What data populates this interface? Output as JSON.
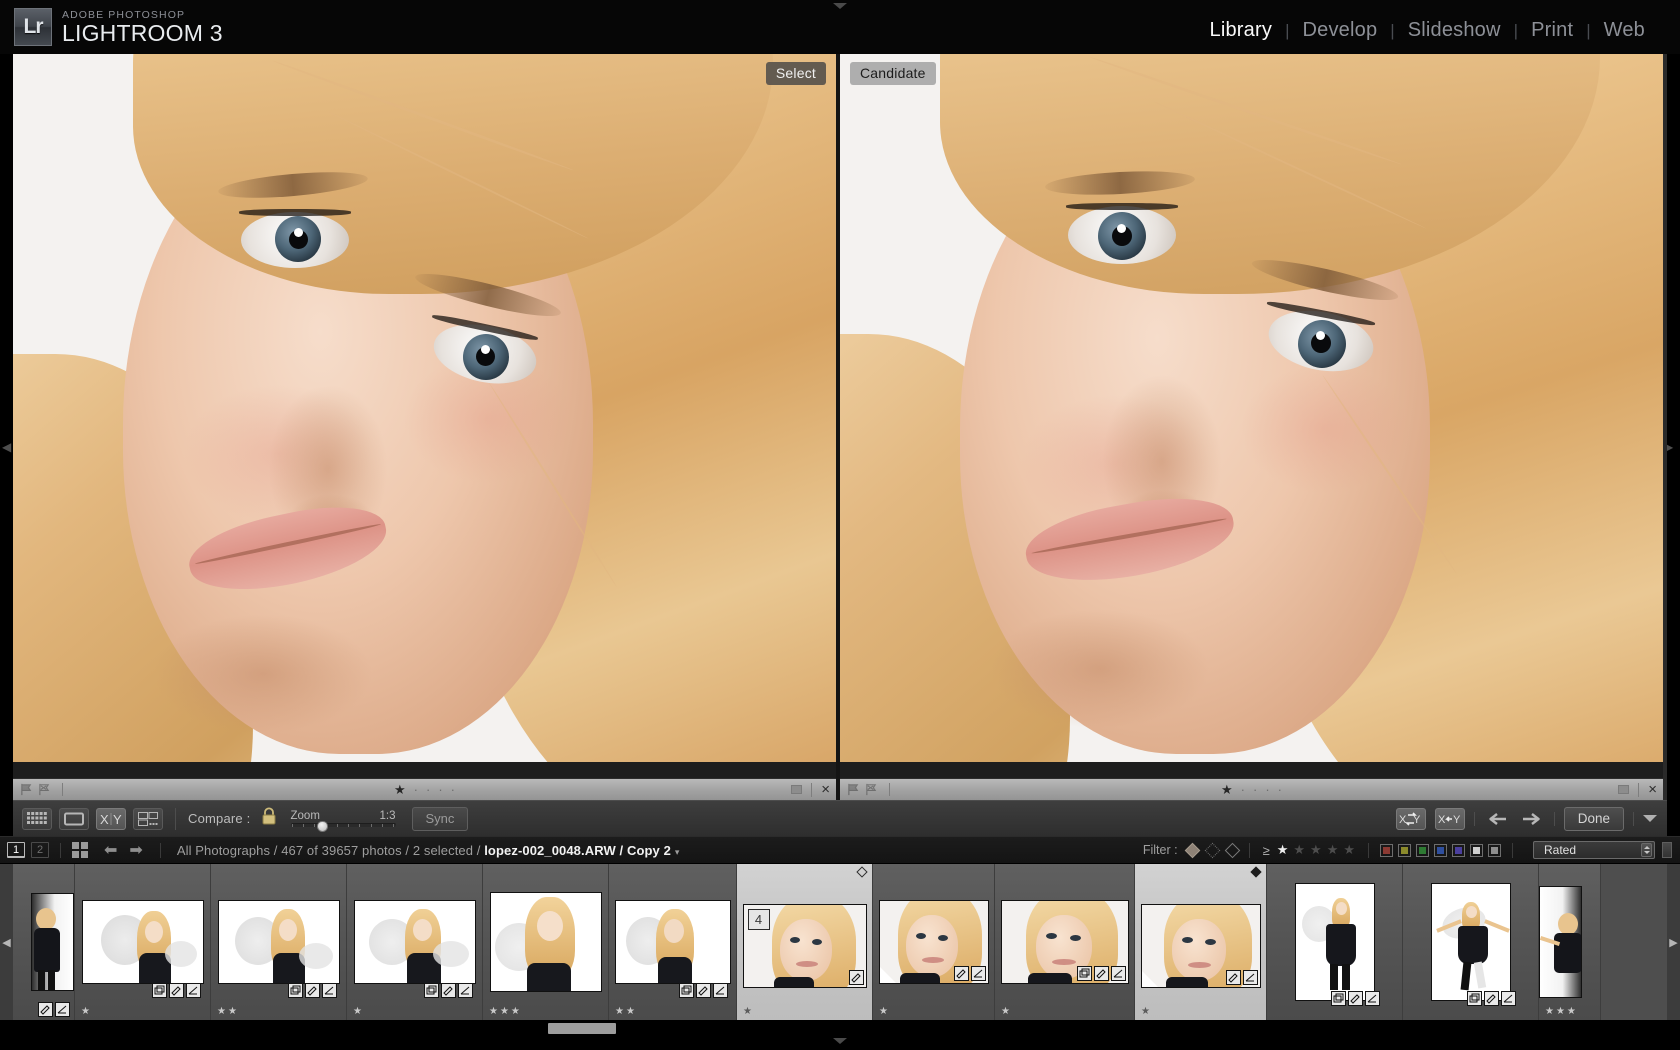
{
  "app": {
    "brand_sub": "ADOBE PHOTOSHOP",
    "brand_main": "LIGHTROOM",
    "brand_version": "3",
    "logo_text": "Lr"
  },
  "modules": [
    {
      "label": "Library",
      "active": true
    },
    {
      "label": "Develop",
      "active": false
    },
    {
      "label": "Slideshow",
      "active": false
    },
    {
      "label": "Print",
      "active": false
    },
    {
      "label": "Web",
      "active": false
    }
  ],
  "module_separator": "|",
  "compare": {
    "left_label": "Select",
    "right_label": "Candidate",
    "left_info": {
      "rating_stars": 1,
      "total_stars": 5,
      "flag_icon": "flag-icon",
      "reject_icon": "reject-flag-icon",
      "close_icon": "×"
    },
    "right_info": {
      "rating_stars": 1,
      "total_stars": 5,
      "flag_icon": "flag-icon",
      "reject_icon": "reject-flag-icon",
      "close_icon": "×"
    }
  },
  "toolbar": {
    "view_buttons": [
      {
        "name": "grid-view",
        "icon": "grid-icon",
        "selected": false
      },
      {
        "name": "loupe-view",
        "icon": "loupe-icon",
        "selected": false
      },
      {
        "name": "compare-view",
        "icon": "compare-xy-icon",
        "selected": true
      },
      {
        "name": "survey-view",
        "icon": "survey-icon",
        "selected": false
      }
    ],
    "compare_label": "Compare :",
    "lock_icon": "lock-icon",
    "zoom_label": "Zoom",
    "zoom_value": "1:3",
    "sync_label": "Sync",
    "swap_icon": "swap-xy-icon",
    "make_select_icon": "make-select-icon",
    "prev_icon": "arrow-left-icon",
    "next_icon": "arrow-right-icon",
    "done_label": "Done",
    "caret_icon": "chevron-down-icon"
  },
  "filmstrip_header": {
    "page_primary": "1",
    "page_secondary": "2",
    "grid_icon": "grid-square-icon",
    "back_icon": "arrow-left-icon",
    "forward_icon": "arrow-right-icon",
    "breadcrumb_prefix": "All Photographs / 467 of 39657 photos / 2 selected / ",
    "breadcrumb_file": "lopez-002_0048.ARW / Copy 2",
    "breadcrumb_caret": "▾",
    "filter_label": "Filter :",
    "filter_flags": [
      "flag-pick-filled",
      "flag-unflagged-dotted",
      "flag-reject-outline"
    ],
    "rating_operator": "≥",
    "rating_stars": 1,
    "rating_total": 5,
    "color_labels": [
      "#8c3a33",
      "#8b8a2b",
      "#2e7a33",
      "#2f4f9e",
      "#4b3f9e",
      "#cfcfcf",
      "#8f8f8f"
    ],
    "preset_value": "Rated"
  },
  "filmstrip": {
    "prev_arrow": "◀",
    "next_arrow": "▶",
    "cells": [
      {
        "id": "c0",
        "kind": "partial-left",
        "orientation": "portrait",
        "stars": 0,
        "selected": false,
        "badges": [
          "crop-icon",
          "adjust-icon"
        ],
        "subject": "full-body"
      },
      {
        "id": "c1",
        "kind": "normal",
        "orientation": "landscape",
        "stars": 1,
        "selected": false,
        "badges": [
          "stack-icon",
          "crop-icon",
          "adjust-icon"
        ],
        "subject": "half-body"
      },
      {
        "id": "c2",
        "kind": "normal",
        "orientation": "landscape",
        "stars": 2,
        "selected": false,
        "badges": [
          "stack-icon",
          "crop-icon",
          "adjust-icon"
        ],
        "subject": "half-body"
      },
      {
        "id": "c3",
        "kind": "normal",
        "orientation": "landscape",
        "stars": 1,
        "selected": false,
        "badges": [
          "stack-icon",
          "crop-icon",
          "adjust-icon"
        ],
        "subject": "half-body"
      },
      {
        "id": "c4",
        "kind": "normal",
        "orientation": "portrait",
        "stars": 3,
        "selected": false,
        "badges": [
          "crop-icon",
          "adjust-icon"
        ],
        "subject": "half-body"
      },
      {
        "id": "c5",
        "kind": "normal",
        "orientation": "landscape",
        "stars": 2,
        "selected": false,
        "badges": [
          "stack-icon",
          "crop-icon",
          "adjust-icon"
        ],
        "subject": "half-body"
      },
      {
        "id": "c6",
        "kind": "normal",
        "orientation": "landscape",
        "stars": 1,
        "selected": true,
        "badge_count": "4",
        "badges": [
          "crop-icon"
        ],
        "pick": "hollow",
        "subject": "face"
      },
      {
        "id": "c7",
        "kind": "normal",
        "orientation": "landscape",
        "stars": 1,
        "selected": false,
        "badges": [
          "crop-icon",
          "adjust-icon"
        ],
        "corner_flag": true,
        "subject": "face"
      },
      {
        "id": "c8",
        "kind": "normal",
        "orientation": "landscape",
        "stars": 1,
        "selected": false,
        "badges": [
          "stack-icon",
          "crop-icon",
          "adjust-icon"
        ],
        "subject": "face"
      },
      {
        "id": "c9",
        "kind": "normal",
        "orientation": "landscape",
        "stars": 1,
        "selected": true,
        "badges": [
          "crop-icon",
          "adjust-icon"
        ],
        "pick": "solid",
        "corner_flag": true,
        "subject": "face"
      },
      {
        "id": "c10",
        "kind": "normal",
        "orientation": "portrait",
        "stars": 0,
        "selected": false,
        "badges": [
          "stack-icon",
          "crop-icon",
          "adjust-icon"
        ],
        "subject": "full-body"
      },
      {
        "id": "c11",
        "kind": "normal",
        "orientation": "portrait",
        "stars": 0,
        "selected": false,
        "badges": [
          "stack-icon",
          "crop-icon",
          "adjust-icon"
        ],
        "subject": "full-body-arms"
      },
      {
        "id": "c12",
        "kind": "partial-right",
        "orientation": "portrait",
        "stars": 3,
        "selected": false,
        "badges": [],
        "subject": "full-body-arms"
      }
    ]
  },
  "panels": {
    "left_toggle": "◀",
    "right_toggle": "▶",
    "top_toggle": "▲",
    "bottom_toggle": "▼"
  }
}
